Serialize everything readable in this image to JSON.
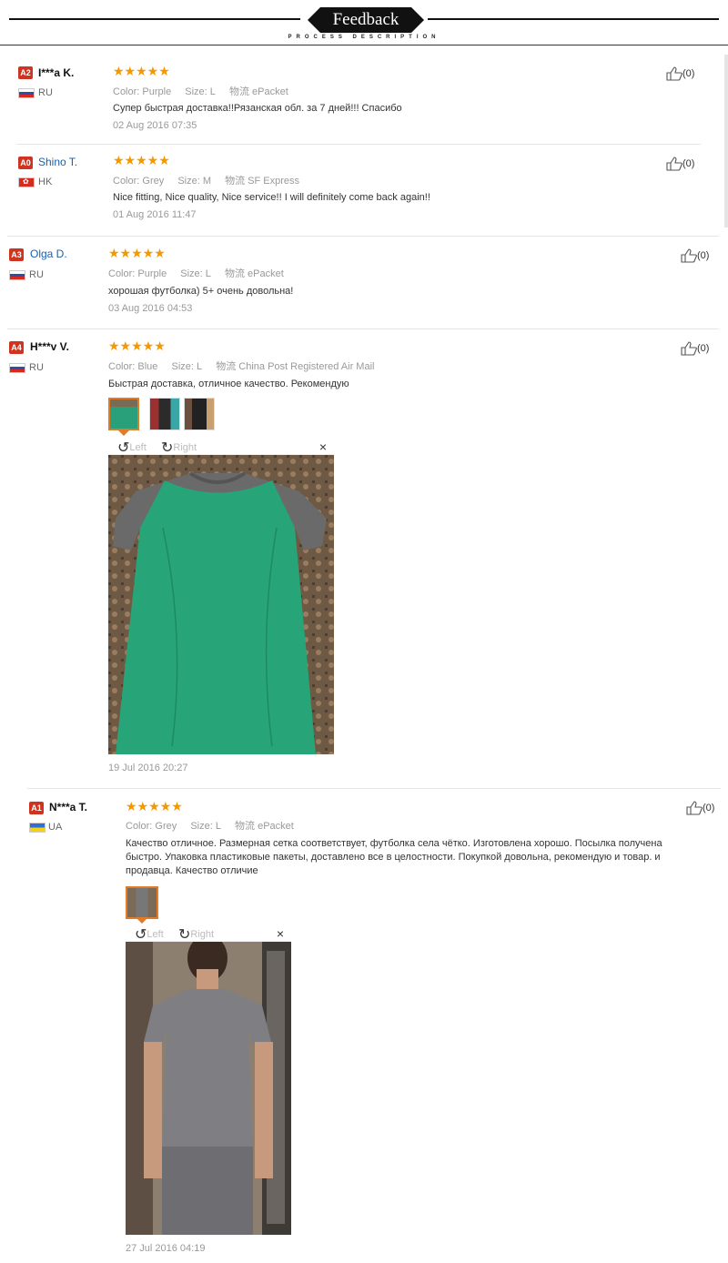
{
  "header": {
    "title": "Feedback",
    "subtitle": "PROCESS DESCRIPTION"
  },
  "labels": {
    "color": "Color:",
    "size": "Size:",
    "shipping": "物流",
    "rotate_left": "Left",
    "rotate_right": "Right",
    "close": "×"
  },
  "reviews": [
    {
      "badge": "A2",
      "name": "I***a K.",
      "country": "RU",
      "stars": "★★★★★",
      "color": "Purple",
      "size": "L",
      "shipping": "ePacket",
      "text": "Супер быстрая доставка!!Рязанская обл. за 7 дней!!! Спасибо",
      "date": "02 Aug 2016 07:35",
      "likes": "(0)"
    },
    {
      "badge": "A0",
      "name": "Shino T.",
      "country": "HK",
      "stars": "★★★★★",
      "color": "Grey",
      "size": "M",
      "shipping": "SF Express",
      "text": "Nice fitting, Nice quality, Nice service!! I will definitely come back again!!",
      "date": "01 Aug 2016 11:47",
      "likes": "(0)"
    },
    {
      "badge": "A3",
      "name": "Olga D.",
      "country": "RU",
      "stars": "★★★★★",
      "color": "Purple",
      "size": "L",
      "shipping": "ePacket",
      "text": "хорошая футболка) 5+ очень довольна!",
      "date": "03 Aug 2016 04:53",
      "likes": "(0)"
    },
    {
      "badge": "A4",
      "name": "H***v V.",
      "country": "RU",
      "stars": "★★★★★",
      "color": "Blue",
      "size": "L",
      "shipping": "China Post Registered Air Mail",
      "text": "Быстрая доставка, отличное качество. Рекомендую",
      "date": "19 Jul 2016 20:27",
      "likes": "(0)"
    },
    {
      "badge": "A1",
      "name": "N***a T.",
      "country": "UA",
      "stars": "★★★★★",
      "color": "Grey",
      "size": "L",
      "shipping": "ePacket",
      "text": "Качество отличное. Размерная сетка соответствует, футболка села чётко. Изготовлена хорошо. Посылка получена быстро. Упаковка пластиковые пакеты, доставлено все в целостности. Покупкой довольна, рекомендую и товар. и продавца. Качество отличие",
      "date": "27 Jul 2016 04:19",
      "likes": "(0)"
    }
  ]
}
